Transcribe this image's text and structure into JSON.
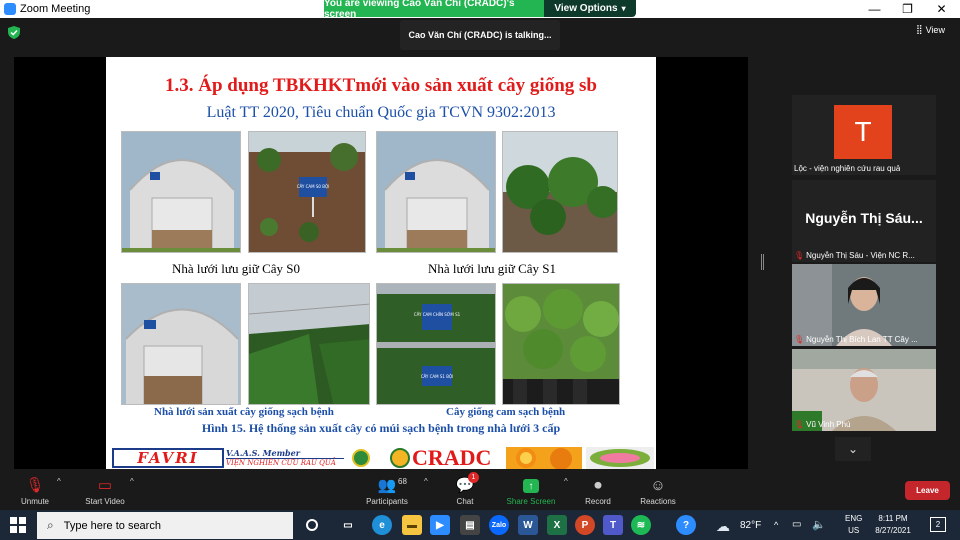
{
  "window": {
    "title": "Zoom Meeting",
    "banner": "You are viewing Cao Văn Chí (CRADC)'s screen",
    "view_options": "View Options",
    "minimize": "—",
    "restore": "❐",
    "close": "✕"
  },
  "meeting": {
    "talking": "Cao Văn Chí (CRADC) is talking...",
    "view_label": "View"
  },
  "slide": {
    "title": "1.3. Áp dụng TBKHKTmới vào sản xuất cây giống sb",
    "subtitle": "Luật TT 2020, Tiêu chuẩn Quốc gia TCVN 9302:2013",
    "sign_1": "CÂY CAM S0 BỘI",
    "caption_s0": "Nhà lưới lưu giữ Cây S0",
    "caption_s1": "Nhà lưới lưu giữ Cây S1",
    "sign_2": "CÂY CAM CHÍN SỚM S1",
    "sign_3": "CÂY CAM S1 BỘI",
    "caption_nursery": "Nhà lưới sản xuất cây giống sạch bệnh",
    "caption_seedling": "Cây giống cam sạch bệnh",
    "figure_caption": "Hình 15. Hệ thống sản xuất cây có múi sạch bệnh trong nhà lưới 3 cấp",
    "logos": {
      "favri": "FAVRI",
      "vaas": "V.A.A.S. Member",
      "institute": "VIỆN NGHIÊN CỨU RAU QUẢ",
      "cradc": "CRADC"
    }
  },
  "participants_panel": [
    {
      "initial": "T",
      "avatar_color": "#e2431d",
      "label": "Lộc - viện nghiên cứu rau quả",
      "muted": false
    },
    {
      "display_name": "Nguyễn Thị Sáu...",
      "label": "Nguyễn Thị Sáu - Viện NC R...",
      "muted": true
    },
    {
      "label": "Nguyễn Thị Bích Lan TT Cây ...",
      "muted": true
    },
    {
      "label": "Vũ Vinh Phú",
      "muted": true
    }
  ],
  "toolbar": {
    "unmute": "Unmute",
    "start_video": "Start Video",
    "participants": "Participants",
    "participants_count": "68",
    "chat": "Chat",
    "chat_badge": "1",
    "share_screen": "Share Screen",
    "record": "Record",
    "reactions": "Reactions",
    "leave": "Leave"
  },
  "taskbar": {
    "search_placeholder": "Type here to search",
    "weather": "82°F",
    "lang_top": "ENG",
    "lang_bottom": "US",
    "time": "8:11 PM",
    "date": "8/27/2021",
    "notifications": "2"
  },
  "colors": {
    "banner_green": "#23b551",
    "leave_red": "#c5262b",
    "slide_title_red": "#e11a1a",
    "slide_blue": "#1c4fa8"
  }
}
